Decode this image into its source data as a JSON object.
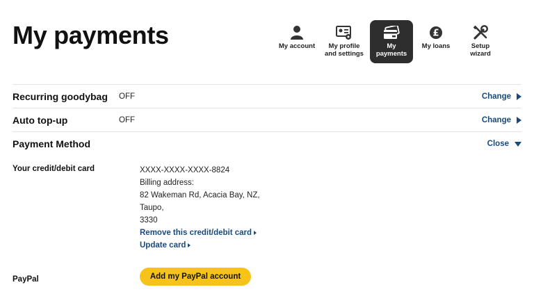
{
  "page": {
    "title": "My payments"
  },
  "nav": {
    "items": [
      {
        "label": "My account",
        "icon": "person-icon"
      },
      {
        "label": "My profile\nand settings",
        "icon": "profile-settings-icon"
      },
      {
        "label": "My\npayments",
        "icon": "credit-card-icon",
        "active": true
      },
      {
        "label": "My loans",
        "icon": "pound-coin-icon"
      },
      {
        "label": "Setup\nwizard",
        "icon": "tools-icon"
      }
    ]
  },
  "settings": {
    "recurring": {
      "label": "Recurring goodybag",
      "value": "OFF",
      "action": "Change"
    },
    "autotopup": {
      "label": "Auto top-up",
      "value": "OFF",
      "action": "Change"
    },
    "payment_method": {
      "label": "Payment Method",
      "action": "Close"
    }
  },
  "card": {
    "section_label": "Your credit/debit card",
    "number": "XXXX-XXXX-XXXX-8824",
    "billing_label": "Billing address:",
    "address_line1": "82 Wakeman Rd, Acacia Bay, NZ,",
    "address_line2": "Taupo,",
    "postcode": "3330",
    "remove_link": "Remove this credit/debit card",
    "update_link": "Update card"
  },
  "paypal": {
    "section_label": "PayPal",
    "button_label": "Add my PayPal account"
  },
  "colors": {
    "link": "#1a4a7a",
    "active_nav": "#2e2e2e",
    "paypal_button": "#f7c31b"
  }
}
